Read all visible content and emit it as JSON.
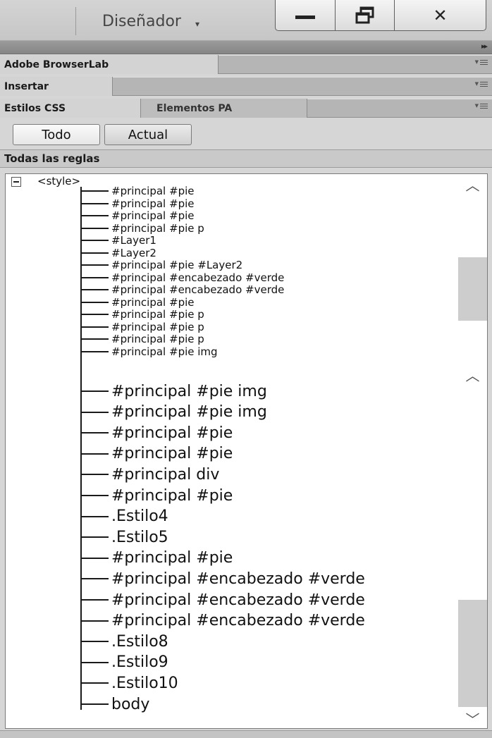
{
  "titlebar": {
    "workspace_label": "Diseñador",
    "workspace_caret": "▾",
    "minimize_label": "Minimizar",
    "restore_label": "Restaurar",
    "close_label": "✕"
  },
  "collapse_strip": {
    "expand_glyph": "▸▸"
  },
  "panels": [
    {
      "tabs": [
        "Adobe BrowserLab"
      ]
    },
    {
      "tabs": [
        "Insertar"
      ]
    },
    {
      "tabs": [
        "Estilos CSS",
        "Elementos PA"
      ]
    }
  ],
  "css_panel": {
    "toggle_all": "Todo",
    "toggle_current": "Actual",
    "selected_toggle": "Todo",
    "section_title": "Todas las reglas",
    "root_node": "<style>",
    "upper_rules": [
      "#principal #pie",
      "#principal #pie",
      "#principal #pie",
      "#principal #pie p",
      "#Layer1",
      "#Layer2",
      "#principal #pie #Layer2",
      "#principal #encabezado #verde",
      "#principal #encabezado #verde",
      "#principal #pie",
      "#principal #pie p",
      "#principal #pie p",
      "#principal #pie p",
      "#principal #pie img"
    ],
    "lower_rules": [
      "#principal #pie img",
      "#principal #pie img",
      "#principal #pie",
      "#principal #pie",
      "#principal div",
      "#principal #pie",
      ".Estilo4",
      ".Estilo5",
      "#principal #pie",
      "#principal #encabezado #verde",
      "#principal #encabezado #verde",
      "#principal #encabezado #verde",
      ".Estilo8",
      ".Estilo9",
      ".Estilo10",
      "body"
    ],
    "scroll_up_glyph": "︿",
    "scroll_down_glyph": "﹀"
  },
  "colors": {
    "panel_bg": "#d6d6d6",
    "tab_active": "#d3d3d3",
    "tree_bg": "#ffffff",
    "scroll_thumb": "#cdcdcd"
  }
}
